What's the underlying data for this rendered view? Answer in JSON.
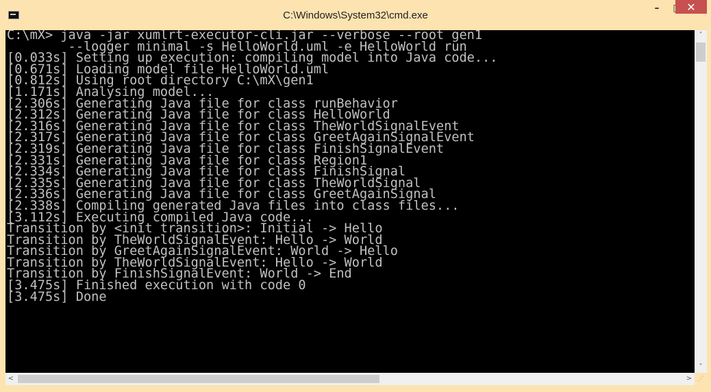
{
  "window": {
    "title": "C:\\Windows\\System32\\cmd.exe",
    "icons": {
      "app": "cmd-icon",
      "minimize": "minimize-icon",
      "maximize": "maximize-icon",
      "close": "close-icon"
    },
    "controls": {
      "minimize": "–",
      "maximize": "□",
      "close": "✕"
    },
    "accent_color": "#fce3b0",
    "close_color": "#c75050"
  },
  "console": {
    "background": "#000000",
    "foreground": "#c0c0c0",
    "lines": [
      "C:\\mX> java -jar xumlrt-executor-cli.jar --verbose --root gen1",
      "        --logger minimal -s HelloWorld.uml -e HelloWorld run",
      "[0.033s] Setting up execution: compiling model into Java code...",
      "[0.671s] Loading model file HelloWorld.uml",
      "[0.812s] Using root directory C:\\mX\\gen1",
      "[1.171s] Analysing model...",
      "[2.306s] Generating Java file for class runBehavior",
      "[2.312s] Generating Java file for class HelloWorld",
      "[2.316s] Generating Java file for class TheWorldSignalEvent",
      "[2.317s] Generating Java file for class GreetAgainSignalEvent",
      "[2.319s] Generating Java file for class FinishSignalEvent",
      "[2.331s] Generating Java file for class Region1",
      "[2.334s] Generating Java file for class FinishSignal",
      "[2.335s] Generating Java file for class TheWorldSignal",
      "[2.336s] Generating Java file for class GreetAgainSignal",
      "[2.338s] Compiling generated Java files into class files...",
      "[3.112s] Executing compiled Java code...",
      "Transition by <init transition>: Initial -> Hello",
      "Transition by TheWorldSignalEvent: Hello -> World",
      "Transition by GreetAgainSignalEvent: World -> Hello",
      "Transition by TheWorldSignalEvent: Hello -> World",
      "Transition by FinishSignalEvent: World -> End",
      "[3.475s] Finished execution with code 0",
      "[3.475s] Done"
    ]
  },
  "scrollbars": {
    "up_arrow": "˄",
    "down_arrow": "˅",
    "left_arrow": "<",
    "right_arrow": ">",
    "grip": "⋰"
  }
}
